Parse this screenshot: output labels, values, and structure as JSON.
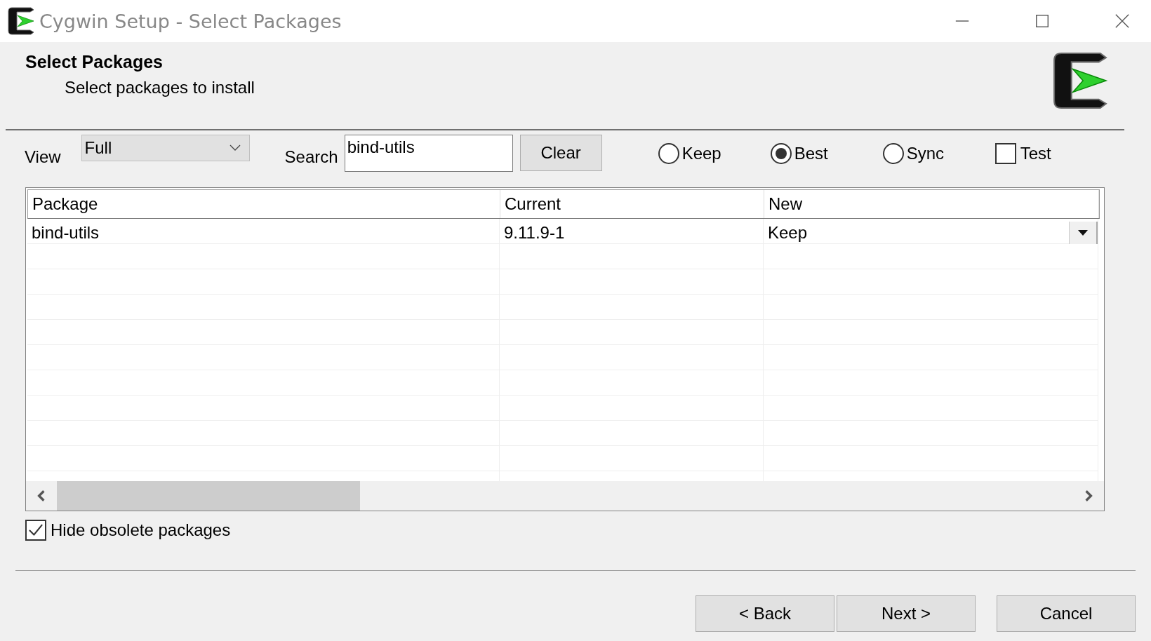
{
  "window": {
    "title": "Cygwin Setup - Select Packages"
  },
  "header": {
    "title": "Select Packages",
    "subtitle": "Select packages to install"
  },
  "toolbar": {
    "view_label": "View",
    "view_value": "Full",
    "search_label": "Search",
    "search_value": "bind-utils",
    "clear_button": "Clear",
    "options": [
      {
        "kind": "radio",
        "label": "Keep",
        "selected": false
      },
      {
        "kind": "radio",
        "label": "Best",
        "selected": true
      },
      {
        "kind": "radio",
        "label": "Sync",
        "selected": false
      },
      {
        "kind": "checkbox",
        "label": "Test",
        "checked": false
      }
    ]
  },
  "table": {
    "columns": [
      "Package",
      "Current",
      "New"
    ],
    "rows": [
      {
        "package": "bind-utils",
        "current": "9.11.9-1",
        "new": "Keep"
      }
    ]
  },
  "hide_obsolete": {
    "label": "Hide obsolete packages",
    "checked": true
  },
  "buttons": [
    "< Back",
    "Next >",
    "Cancel"
  ]
}
